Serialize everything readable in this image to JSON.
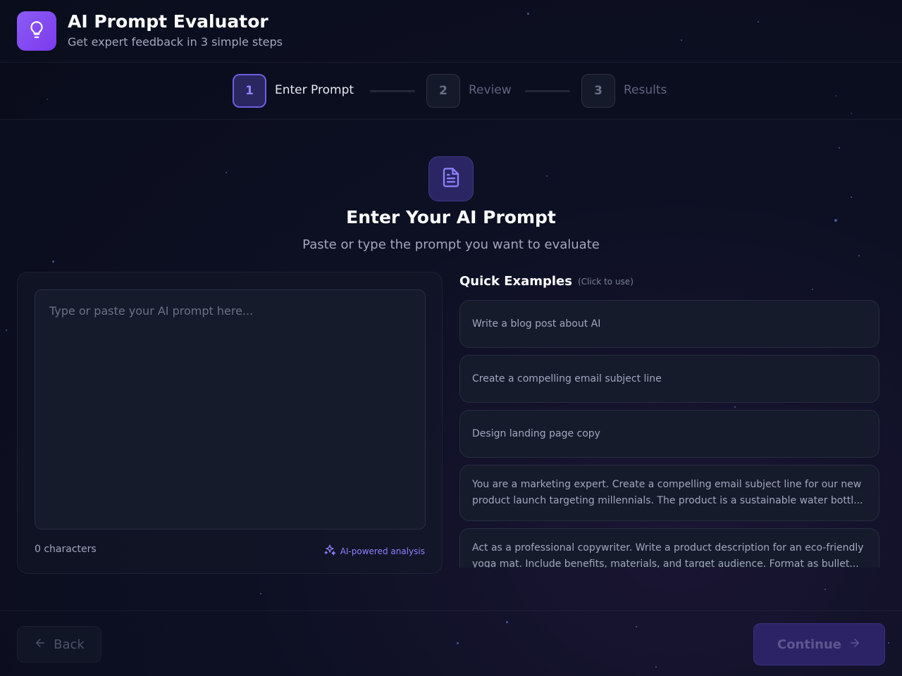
{
  "header": {
    "title": "AI Prompt Evaluator",
    "subtitle": "Get expert feedback in 3 simple steps",
    "logo_icon": "lightbulb-icon"
  },
  "stepper": {
    "steps": [
      {
        "number": "1",
        "label": "Enter Prompt",
        "state": "active"
      },
      {
        "number": "2",
        "label": "Review",
        "state": "inactive"
      },
      {
        "number": "3",
        "label": "Results",
        "state": "inactive"
      }
    ]
  },
  "main": {
    "icon": "document-icon",
    "title": "Enter Your AI Prompt",
    "subtitle": "Paste or type the prompt you want to evaluate"
  },
  "editor": {
    "value": "",
    "placeholder": "Type or paste your AI prompt here...",
    "char_count": "0 characters",
    "ai_badge": "AI-powered analysis",
    "ai_badge_icon": "sparkles-icon"
  },
  "examples": {
    "title": "Quick Examples",
    "hint": "(Click to use)",
    "items": [
      {
        "text": "Write a blog post about AI"
      },
      {
        "text": "Create a compelling email subject line"
      },
      {
        "text": "Design landing page copy"
      },
      {
        "text": "You are a marketing expert. Create a compelling email subject line for our new product launch targeting millennials. The product is a sustainable water bottl..."
      },
      {
        "text": "Act as a professional copywriter. Write a product description for an eco-friendly yoga mat. Include benefits, materials, and target audience. Format as bullet..."
      }
    ]
  },
  "footer": {
    "back_label": "Back",
    "continue_label": "Continue"
  },
  "colors": {
    "accent": "#8b5cf6",
    "active_step": "#6d5fe0",
    "background": "#0d1023"
  }
}
